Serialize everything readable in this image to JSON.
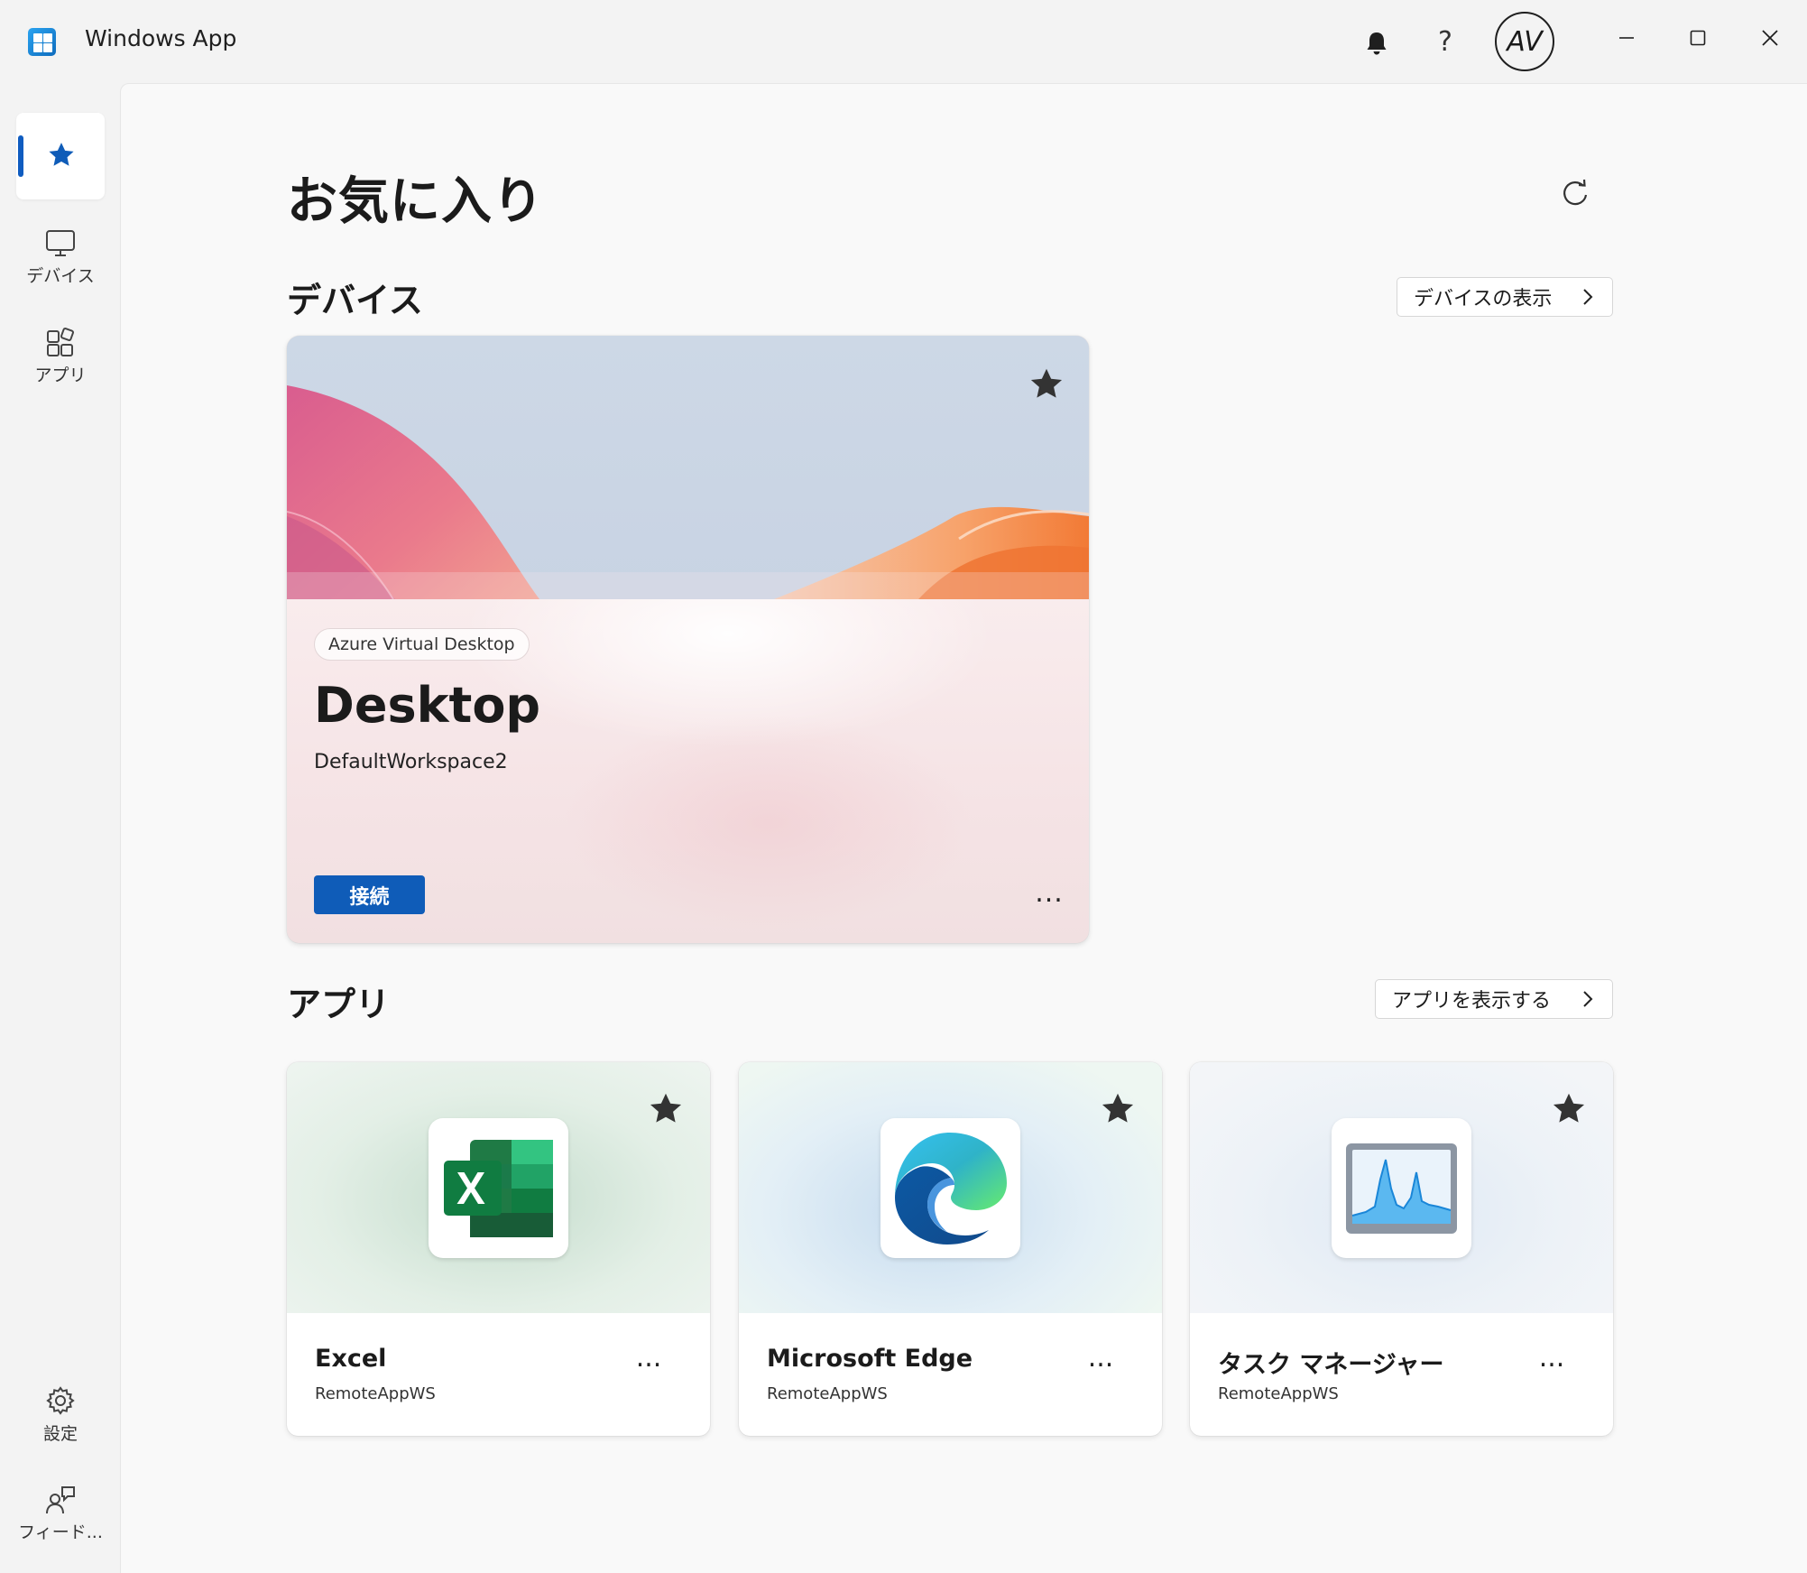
{
  "window": {
    "title": "Windows App"
  },
  "header": {
    "avatar_initials": "AV",
    "help_label": "?"
  },
  "sidebar": {
    "items": [
      {
        "label": "",
        "icon": "star-icon",
        "selected": true
      },
      {
        "label": "デバイス",
        "icon": "monitor-icon"
      },
      {
        "label": "アプリ",
        "icon": "apps-icon"
      },
      {
        "label": "設定",
        "icon": "gear-icon"
      },
      {
        "label": "フィード...",
        "icon": "feedback-icon"
      }
    ]
  },
  "main": {
    "title": "お気に入り",
    "devices": {
      "heading": "デバイス",
      "show_all": "デバイスの表示",
      "card": {
        "badge": "Azure Virtual Desktop",
        "name": "Desktop",
        "workspace": "DefaultWorkspace2",
        "connect": "接続",
        "more": "..."
      }
    },
    "apps": {
      "heading": "アプリ",
      "show_all": "アプリを表示する",
      "items": [
        {
          "name": "Excel",
          "workspace": "RemoteAppWS",
          "icon": "excel-icon",
          "more": "..."
        },
        {
          "name": "Microsoft Edge",
          "workspace": "RemoteAppWS",
          "icon": "edge-icon",
          "more": "..."
        },
        {
          "name": "タスク マネージャー",
          "workspace": "RemoteAppWS",
          "icon": "task-manager-icon",
          "more": "..."
        }
      ]
    }
  },
  "colors": {
    "accent": "#0f5cb8",
    "background": "#f3f3f3",
    "panel": "#f9f9f9"
  }
}
